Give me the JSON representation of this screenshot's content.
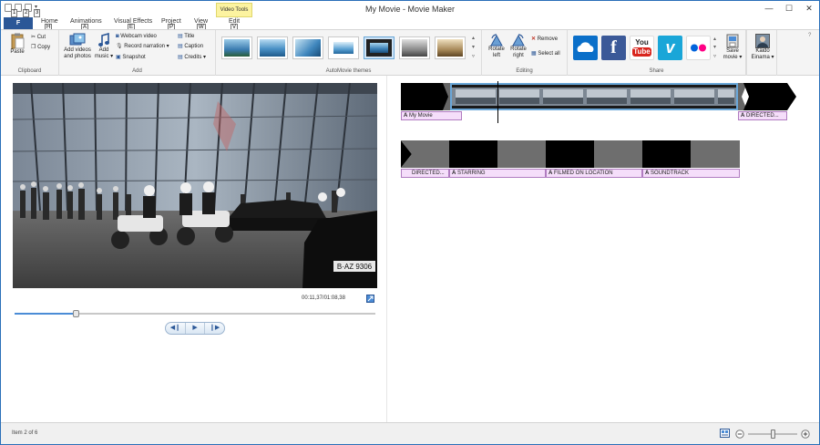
{
  "window": {
    "title": "My Movie - Movie Maker",
    "minimize": "—",
    "maximize": "☐",
    "close": "✕"
  },
  "qat": {
    "keytips": [
      "1",
      "2",
      "3"
    ]
  },
  "tabs": {
    "file": "F",
    "home": "Home",
    "home_key": "H",
    "animations": "Animations",
    "animations_key": "A",
    "visual_effects": "Visual Effects",
    "visual_effects_key": "E",
    "project": "Project",
    "project_key": "P",
    "view": "View",
    "view_key": "W",
    "video_tools": "Video Tools",
    "edit": "Edit",
    "edit_key": "V"
  },
  "ribbon": {
    "clipboard": {
      "label": "Clipboard",
      "paste": "Paste",
      "cut": "Cut",
      "copy": "Copy"
    },
    "add": {
      "label": "Add",
      "add_videos_1": "Add videos",
      "add_videos_2": "and photos",
      "add_music_1": "Add",
      "add_music_2": "music",
      "webcam": "Webcam video",
      "narration": "Record narration",
      "snapshot": "Snapshot",
      "title": "Title",
      "caption": "Caption",
      "credits": "Credits"
    },
    "themes": {
      "label": "AutoMovie themes",
      "selected_index": 4
    },
    "editing": {
      "label": "Editing",
      "rotate_left_1": "Rotate",
      "rotate_left_2": "left",
      "rotate_right_1": "Rotate",
      "rotate_right_2": "right",
      "remove": "Remove",
      "select_all": "Select all"
    },
    "share": {
      "label": "Share",
      "youtube_1": "You",
      "youtube_2": "Tube",
      "save_movie_1": "Save",
      "save_movie_2": "movie",
      "user_1": "Kaido",
      "user_2": "Einama"
    }
  },
  "preview": {
    "timecode": "00:11,37/01:08,38",
    "plate": "B·AZ 9306",
    "seek_fraction": 0.17,
    "prev": "◀❙",
    "play": "▶",
    "next": "❙▶"
  },
  "storyboard": {
    "row1_captions": [
      "My Movie",
      "DIRECTED..."
    ],
    "row2_captions": [
      "DIRECTED...",
      "STARRING",
      "FILMED ON LOCATION",
      "SOUNDTRACK"
    ]
  },
  "status": {
    "item": "Item 2 of 6",
    "zoom_fraction": 0.5
  },
  "colors": {
    "file_tab": "#2b5797",
    "accent": "#4b8cd6",
    "caption_bg": "#f5defa",
    "video_tools": "#fcf3a0"
  }
}
